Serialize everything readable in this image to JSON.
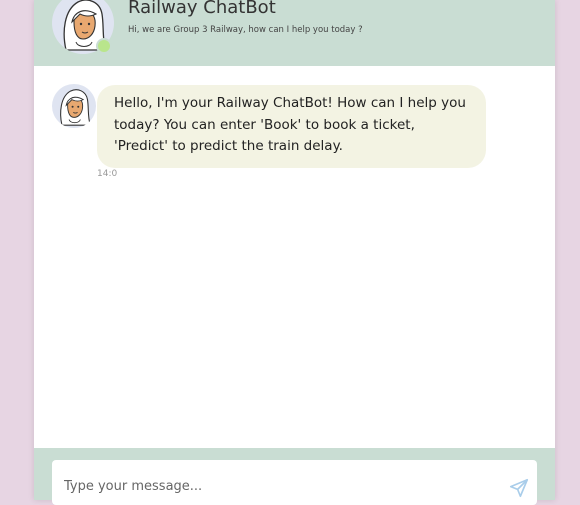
{
  "header": {
    "title": "Railway ChatBot",
    "subtitle": "Hi, we are Group 3 Railway, how can I help you today ?"
  },
  "messages": [
    {
      "sender": "bot",
      "text": "Hello, I'm your Railway ChatBot! How can I help you today? You can enter 'Book' to book a ticket, 'Predict' to predict the train delay.",
      "time": "14:0"
    }
  ],
  "composer": {
    "placeholder": "Type your message..."
  },
  "icons": {
    "avatar": "woman-avatar-icon",
    "online": "online-status-dot",
    "send": "send-paper-plane-icon"
  },
  "colors": {
    "page_background": "#e7d5e3",
    "header_background": "#c9ddd3",
    "bot_bubble": "#f3f3e3",
    "online_dot": "#b9e58c"
  }
}
